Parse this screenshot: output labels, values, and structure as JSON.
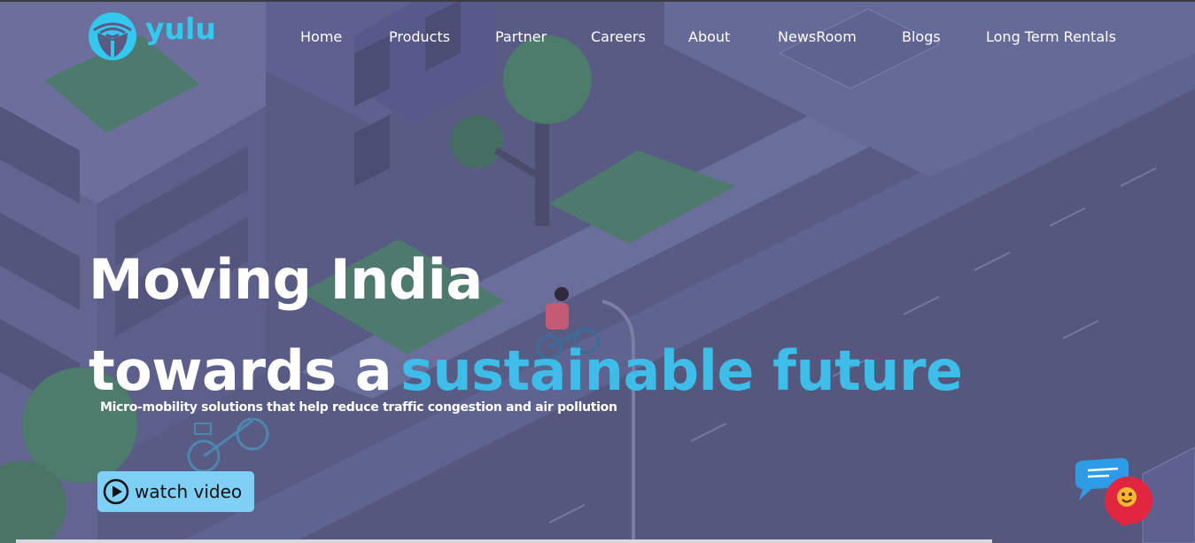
{
  "brand": {
    "name": "yulu",
    "logo_icon": "yulu-logo-icon",
    "color": "#33c8ee"
  },
  "nav": {
    "items": [
      {
        "label": "Home"
      },
      {
        "label": "Products"
      },
      {
        "label": "Partner"
      },
      {
        "label": "Careers"
      },
      {
        "label": "About"
      },
      {
        "label": "NewsRoom"
      },
      {
        "label": "Blogs"
      },
      {
        "label": "Long Term Rentals"
      }
    ]
  },
  "hero": {
    "headline_line1": "Moving India",
    "headline_line2_prefix": "towards a",
    "headline_line2_accent": "sustainable future",
    "subheadline": "Micro-mobility solutions that help reduce traffic congestion and air pollution",
    "accent_color": "#3dbde8",
    "cta": {
      "label": "watch video",
      "icon": "play-icon",
      "background": "#7fd0f7"
    }
  },
  "chat": {
    "icon": "chat-bubble-icon"
  }
}
